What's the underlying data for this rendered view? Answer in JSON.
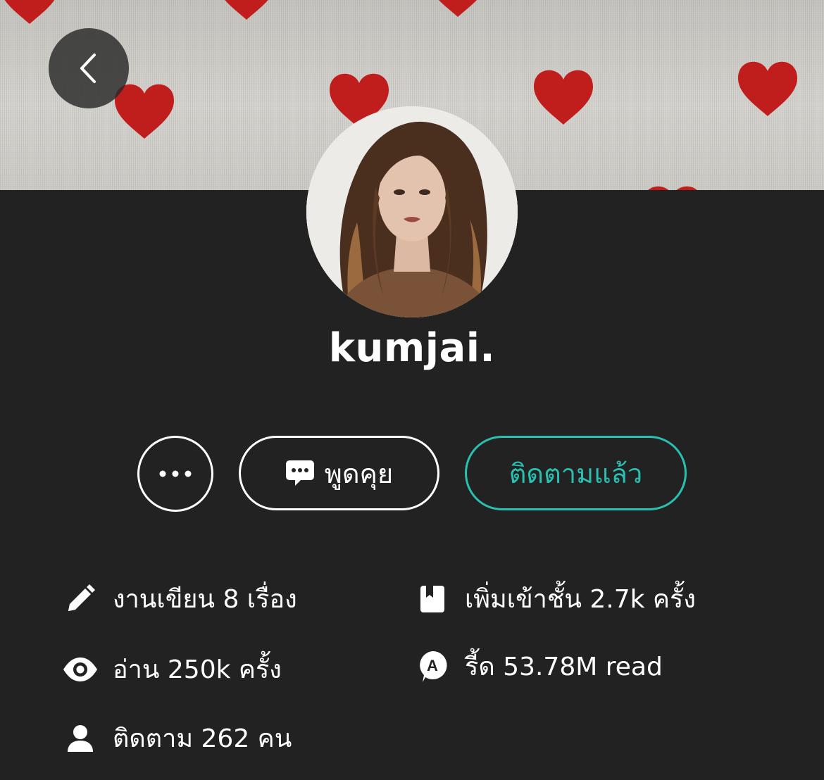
{
  "profile": {
    "username": "kumjai."
  },
  "actions": {
    "chat_label": "พูดคุย",
    "follow_label": "ติดตามแล้ว"
  },
  "stats": {
    "works": "งานเขียน 8 เรื่อง",
    "bookshelf": "เพิ่มเข้าชั้น 2.7k ครั้ง",
    "reads": "อ่าน 250k ครั้ง",
    "reaad": "รี้ด 53.78M read",
    "following": "ติดตาม 262 คน"
  },
  "icons": {
    "back": "chevron-left-icon",
    "more": "more-dots-icon",
    "chat": "chat-bubble-icon",
    "works": "pencil-icon",
    "bookshelf": "bookmark-icon",
    "reads": "eye-icon",
    "reaad": "reaad-coin-icon",
    "following": "person-icon"
  },
  "colors": {
    "background": "#222222",
    "accent": "#29c0b1",
    "text": "#ffffff",
    "heart": "#c8211f"
  }
}
